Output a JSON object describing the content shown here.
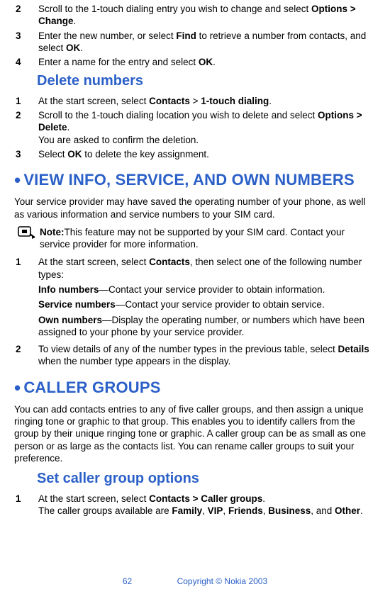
{
  "pre_steps": [
    {
      "n": "2",
      "parts": [
        "Scroll to the 1-touch dialing entry you wish to change and select ",
        {
          "b": "Options > Change"
        },
        "."
      ]
    },
    {
      "n": "3",
      "parts": [
        "Enter the new number, or select ",
        {
          "b": "Find"
        },
        " to retrieve a number from contacts, and select ",
        {
          "b": "OK"
        },
        "."
      ]
    },
    {
      "n": "4",
      "parts": [
        "Enter a name for the entry and select ",
        {
          "b": "OK"
        },
        "."
      ]
    }
  ],
  "delete_heading": "Delete numbers",
  "delete_steps": [
    {
      "n": "1",
      "parts": [
        "At the start screen, select ",
        {
          "b": "Contacts"
        },
        " > ",
        {
          "b": "1-touch dialing"
        },
        "."
      ]
    },
    {
      "n": "2",
      "parts": [
        "Scroll to the 1-touch dialing location you wish to delete and select ",
        {
          "b": "Options > Delete"
        },
        "."
      ],
      "tail": "You are asked to confirm the deletion."
    },
    {
      "n": "3",
      "parts": [
        "Select ",
        {
          "b": "OK"
        },
        " to delete the key assignment."
      ]
    }
  ],
  "view_heading": "VIEW INFO, SERVICE, AND OWN NUMBERS",
  "view_intro": "Your service provider may have saved the operating number of your phone, as well as various information and service numbers to your SIM card.",
  "note_label": "Note:",
  "note_text": "This feature may not be supported by your SIM card. Contact your service provider for more information.",
  "view_steps": [
    {
      "n": "1",
      "parts": [
        "At the start screen, select ",
        {
          "b": "Contacts"
        },
        ", then select one of the following number types:"
      ],
      "subs": [
        [
          {
            "b": "Info numbers"
          },
          "—Contact your service provider to obtain information."
        ],
        [
          {
            "b": "Service numbers"
          },
          "—Contact your service provider to obtain service."
        ],
        [
          {
            "b": "Own numbers"
          },
          "—Display the operating number, or numbers which have been assigned to your phone by your service provider."
        ]
      ]
    },
    {
      "n": "2",
      "parts": [
        "To view details of any of the number types in the previous table, select ",
        {
          "b": "Details"
        },
        " when the number type appears in the display."
      ]
    }
  ],
  "groups_heading": "CALLER GROUPS",
  "groups_intro": "You can add contacts entries to any of five caller groups, and then assign a unique ringing tone or graphic to that group. This enables you to identify callers from the group by their unique ringing tone or graphic. A caller group can be as small as one person or as large as the contacts list. You can rename caller groups to suit your preference.",
  "set_heading": "Set caller group options",
  "set_steps": [
    {
      "n": "1",
      "parts": [
        "At the start screen, select ",
        {
          "b": "Contacts > Caller groups"
        },
        "."
      ],
      "tail_parts": [
        "The caller groups available are ",
        {
          "b": "Family"
        },
        ", ",
        {
          "b": "VIP"
        },
        ", ",
        {
          "b": "Friends"
        },
        ", ",
        {
          "b": "Business"
        },
        ", and ",
        {
          "b": "Other"
        },
        "."
      ]
    }
  ],
  "footer": {
    "page": "62",
    "copy": "Copyright © Nokia 2003"
  }
}
